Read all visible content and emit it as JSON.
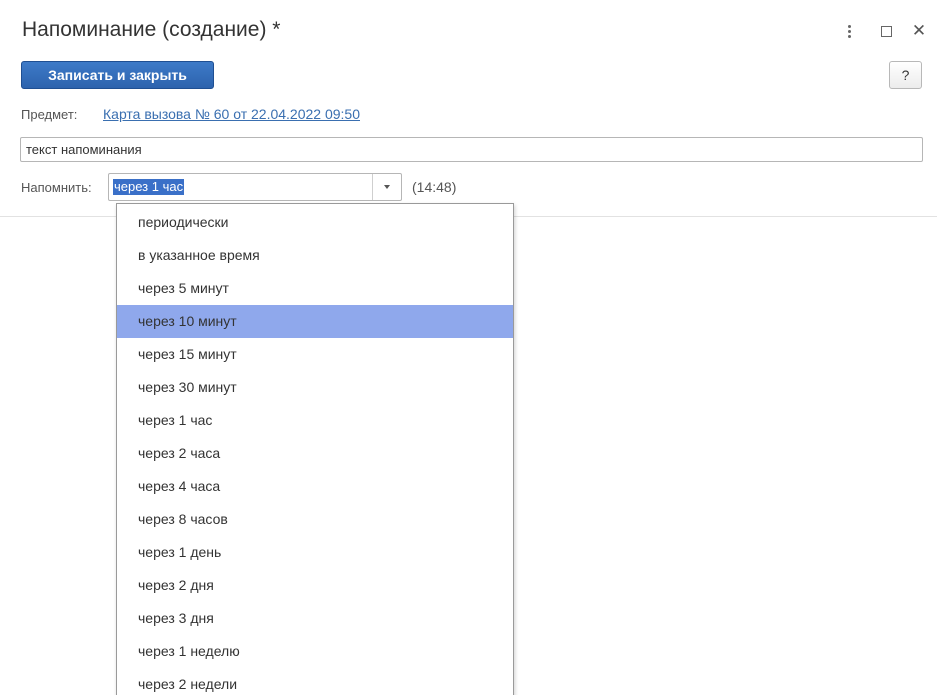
{
  "window": {
    "title": "Напоминание (создание) *",
    "controls": {
      "more_icon": "more-vertical-icon",
      "maximize_icon": "maximize-icon",
      "close_icon": "close-icon",
      "close_glyph": "✕"
    }
  },
  "toolbar": {
    "save_label": "Записать и закрыть",
    "help_label": "?"
  },
  "form": {
    "subject_label": "Предмет:",
    "subject_value": "Карта вызова № 60 от 22.04.2022 09:50",
    "text_value": "текст напоминания",
    "remind_label": "Напомнить:",
    "remind_value": "через 1 час",
    "remind_time": "(14:48)"
  },
  "dropdown": {
    "selected_index": 3,
    "options": [
      "периодически",
      "в указанное время",
      "через 5 минут",
      "через 10 минут",
      "через 15 минут",
      "через 30 минут",
      "через 1 час",
      "через 2 часа",
      "через 4 часа",
      "через 8 часов",
      "через 1 день",
      "через 2 дня",
      "через 3 дня",
      "через 1 неделю",
      "через 2 недели"
    ]
  },
  "colors": {
    "accent": "#2d63ad",
    "link": "#3a6fb0",
    "selection": "#8fa8ec",
    "text_selection": "#3a70c8"
  }
}
